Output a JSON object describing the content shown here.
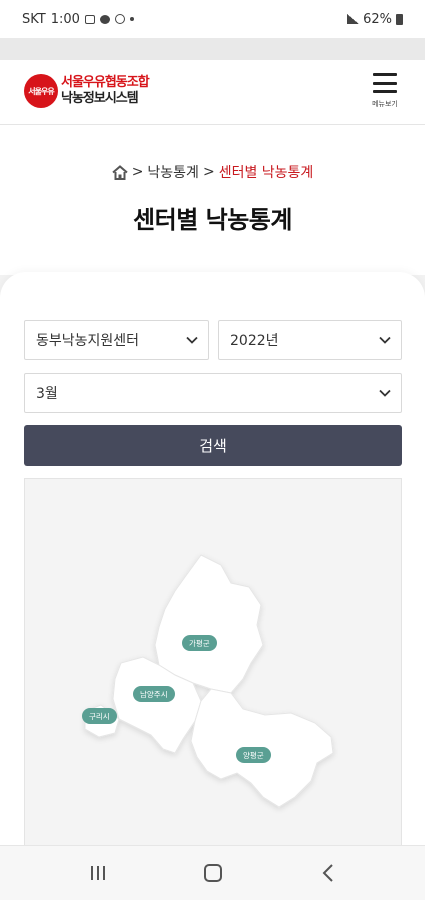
{
  "status": {
    "carrier": "SKT",
    "time": "1:00",
    "battery": "62%",
    "icons": [
      "image-icon",
      "message-icon",
      "ring-icon",
      "dot-icon",
      "signal-icon",
      "battery-icon"
    ]
  },
  "header": {
    "logo_line1": "서울우유협동조합",
    "logo_line2": "낙농정보시스템",
    "logo_mark": "서울우유",
    "menu_label": "메뉴보기"
  },
  "breadcrumb": {
    "item1": "낙농통계",
    "separator": ">",
    "current": "센터별 낙농통계"
  },
  "page": {
    "title": "센터별 낙농통계"
  },
  "filters": {
    "center": "동부낙농지원센터",
    "year": "2022년",
    "month": "3월",
    "search_label": "검색"
  },
  "map": {
    "regions": [
      "가평군",
      "남양주시",
      "구리시",
      "양평군"
    ]
  },
  "colors": {
    "accent": "#c8191f",
    "button": "#464a5c",
    "pill": "#5a9f93"
  }
}
